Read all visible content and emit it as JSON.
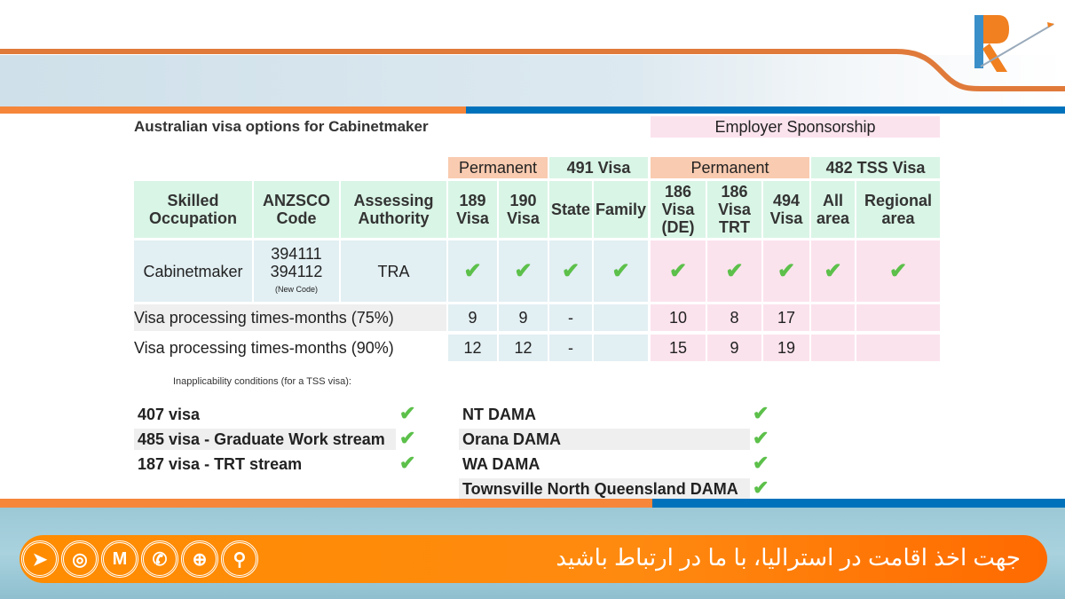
{
  "title": "Australian visa options for Cabinetmaker",
  "employer_sponsorship": "Employer Sponsorship",
  "groups": [
    "Permanent",
    "491 Visa",
    "Permanent",
    "482 TSS Visa"
  ],
  "headers": [
    "Skilled Occupation",
    "ANZSCO Code",
    "Assessing Authority",
    "189 Visa",
    "190 Visa",
    "State",
    "Family",
    "186 Visa (DE)",
    "186 Visa TRT",
    "494 Visa",
    "All area",
    "Regional area"
  ],
  "row": {
    "occupation": "Cabinetmaker",
    "code1": "394111",
    "code2": "394112",
    "code_note": "(New Code)",
    "authority": "TRA",
    "check": "✔"
  },
  "processing": [
    {
      "label": "Visa processing times-months (75%)",
      "values": [
        "9",
        "9",
        "-",
        "",
        "10",
        "8",
        "17",
        "",
        ""
      ]
    },
    {
      "label": "Visa processing times-months (90%)",
      "values": [
        "12",
        "12",
        "-",
        "",
        "15",
        "9",
        "19",
        "",
        ""
      ]
    }
  ],
  "conditions_title": "Inapplicability conditions (for a TSS visa):",
  "conditions_left": [
    "407 visa",
    "485 visa - Graduate Work stream",
    "187 visa - TRT stream"
  ],
  "conditions_right": [
    "NT DAMA",
    "Orana DAMA",
    "WA DAMA",
    "Townsville North Queensland DAMA"
  ],
  "banner": {
    "text": "جهت اخذ اقامت در استرالیا، با ما در ارتباط باشید",
    "icons": [
      "telegram-icon",
      "instagram-icon",
      "m-icon",
      "whatsapp-icon",
      "globe-icon",
      "location-icon"
    ]
  },
  "colors": {
    "orange": "#f5863a",
    "blue": "#0072bc",
    "check": "#5cc04a",
    "green": "#d9f5e6",
    "pink": "#fbe3ed",
    "salmon": "#f9cbb0"
  }
}
